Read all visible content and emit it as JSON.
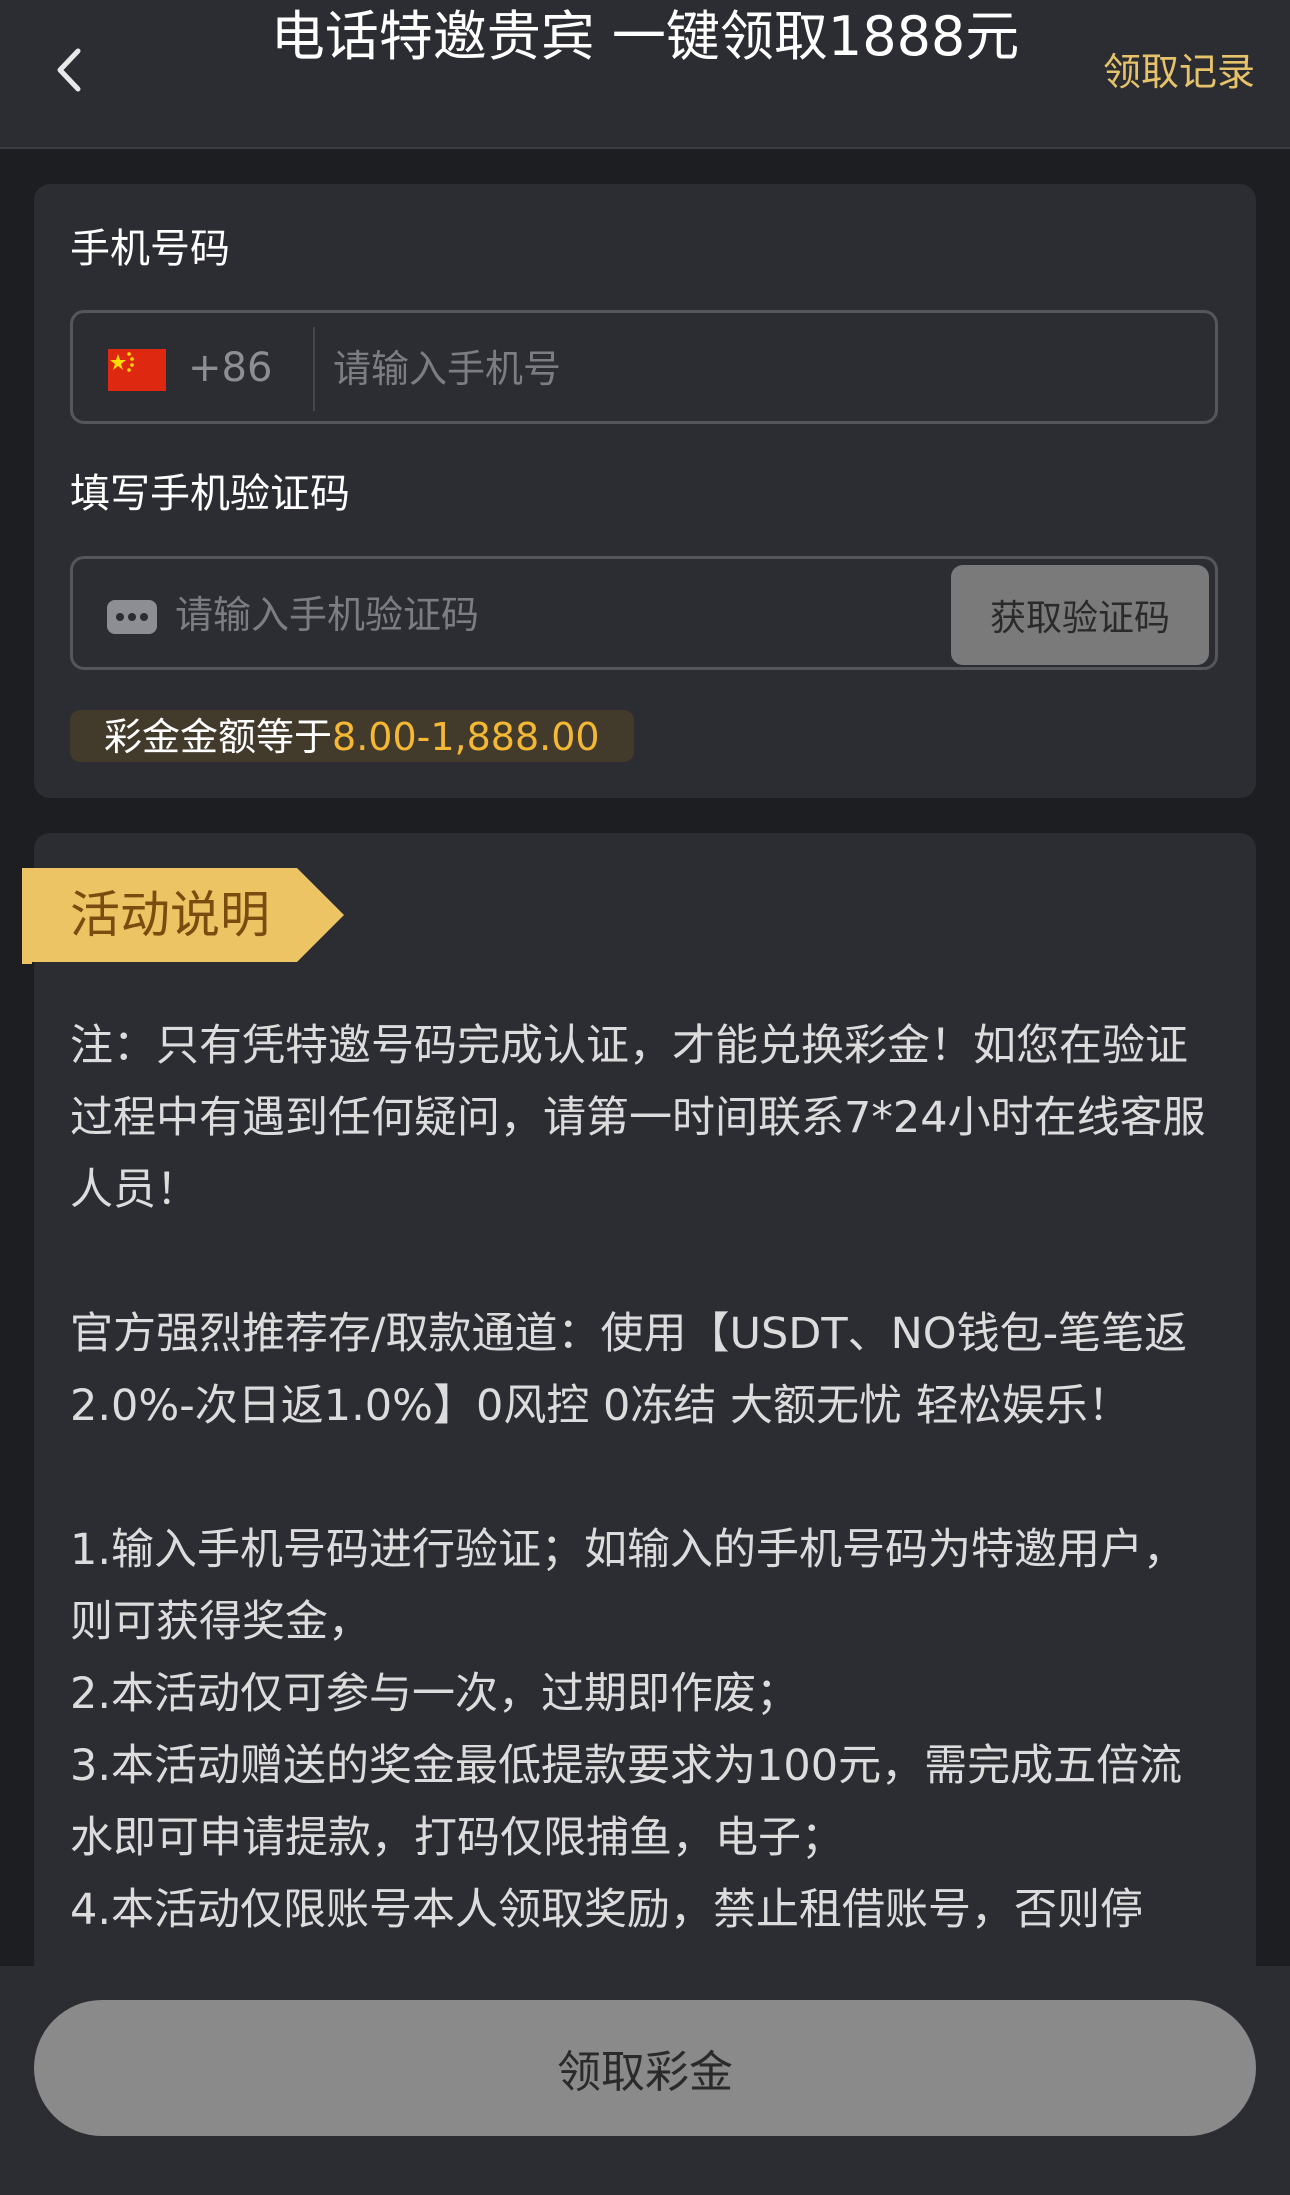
{
  "header": {
    "title": "电话特邀贵宾 一键领取1888元",
    "record_link": "领取记录",
    "back_icon": "chevron-left-icon"
  },
  "form": {
    "phone_label": "手机号码",
    "country_flag": "china-flag-icon",
    "dial_code": "+86",
    "phone_placeholder": "请输入手机号",
    "code_label": "填写手机验证码",
    "code_icon": "chat-bubble-icon",
    "code_placeholder": "请输入手机验证码",
    "get_code_button": "获取验证码",
    "bonus_prefix": "彩金金额等于",
    "bonus_range": "8.00-1,888.00"
  },
  "activity": {
    "ribbon_title": "活动说明",
    "note": "注：只有凭特邀号码完成认证，才能兑换彩金！如您在验证过程中有遇到任何疑问，请第一时间联系7*24小时在线客服人员！",
    "recommend": "官方强烈推荐存/取款通道：使用【USDT、NO钱包-笔笔返2.0%-次日返1.0%】0风控 0冻结 大额无忧 轻松娱乐！",
    "rules": [
      "1.输入手机号码进行验证；如输入的手机号码为特邀用户，则可获得奖金，",
      "2.本活动仅可参与一次，过期即作废；",
      "3.本活动赠送的奖金最低提款要求为100元，需完成五倍流水即可申请提款，打码仅限捕鱼，电子；",
      "4.本活动仅限账号本人领取奖励，禁止租借账号，否则停"
    ]
  },
  "footer": {
    "claim_button": "领取彩金"
  },
  "colors": {
    "background": "#1d1e22",
    "card": "#2c2d32",
    "accent_gold": "#e6c36a",
    "ribbon": "#ecc464",
    "bonus_highlight": "#f5b833",
    "disabled_button": "#8a8a8a"
  }
}
